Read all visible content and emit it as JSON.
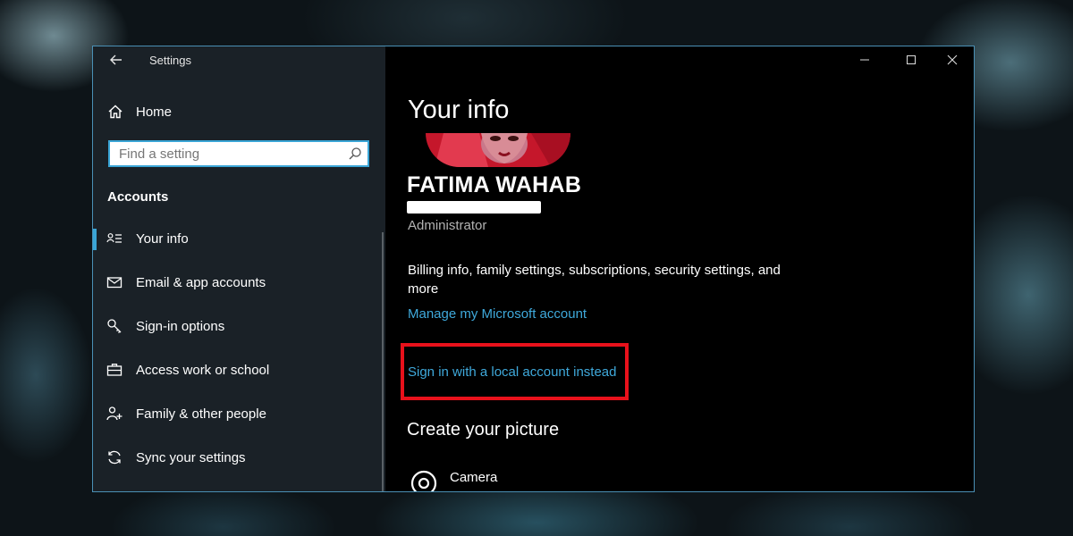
{
  "window": {
    "title": "Settings"
  },
  "sidebar": {
    "home_label": "Home",
    "search": {
      "placeholder": "Find a setting",
      "value": ""
    },
    "section_title": "Accounts",
    "items": [
      {
        "label": "Your info",
        "icon": "contact-card-icon",
        "active": true
      },
      {
        "label": "Email & app accounts",
        "icon": "mail-icon"
      },
      {
        "label": "Sign-in options",
        "icon": "key-icon"
      },
      {
        "label": "Access work or school",
        "icon": "briefcase-icon"
      },
      {
        "label": "Family & other people",
        "icon": "add-person-icon"
      },
      {
        "label": "Sync your settings",
        "icon": "sync-icon"
      }
    ]
  },
  "main": {
    "title": "Your info",
    "user": {
      "name": "FATIMA WAHAB",
      "role": "Administrator"
    },
    "description": "Billing info, family settings, subscriptions, security settings, and more",
    "manage_link": "Manage my Microsoft account",
    "local_account_link": "Sign in with a local account instead",
    "create_picture_title": "Create your picture",
    "camera_label": "Camera"
  },
  "colors": {
    "accent": "#3fa9db",
    "highlight": "#e8111b",
    "sidebar_bg": "#1c242a",
    "content_bg": "#000000"
  }
}
